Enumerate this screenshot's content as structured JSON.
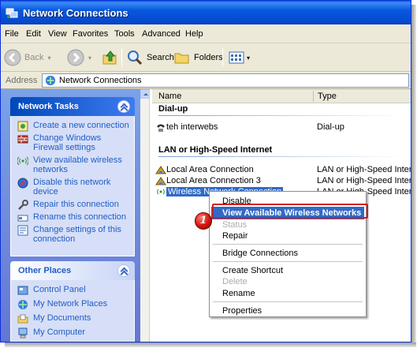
{
  "window": {
    "title": "Network Connections"
  },
  "menubar": {
    "items": [
      "File",
      "Edit",
      "View",
      "Favorites",
      "Tools",
      "Advanced",
      "Help"
    ]
  },
  "toolbar": {
    "back_label": "Back",
    "search_label": "Search",
    "folders_label": "Folders"
  },
  "addressbar": {
    "label": "Address",
    "value": "Network Connections"
  },
  "network_tasks": {
    "title": "Network Tasks",
    "items": [
      {
        "label": "Create a new connection",
        "icon": "new-connection-icon"
      },
      {
        "label": "Change Windows Firewall settings",
        "icon": "firewall-icon"
      },
      {
        "label": "View available wireless networks",
        "icon": "wireless-icon"
      },
      {
        "label": "Disable this network device",
        "icon": "disable-icon"
      },
      {
        "label": "Repair this connection",
        "icon": "repair-icon"
      },
      {
        "label": "Rename this connection",
        "icon": "rename-icon"
      },
      {
        "label": "Change settings of this connection",
        "icon": "settings-icon"
      }
    ]
  },
  "other_places": {
    "title": "Other Places",
    "items": [
      {
        "label": "Control Panel",
        "icon": "control-panel-icon"
      },
      {
        "label": "My Network Places",
        "icon": "network-places-icon"
      },
      {
        "label": "My Documents",
        "icon": "documents-icon"
      },
      {
        "label": "My Computer",
        "icon": "computer-icon"
      }
    ]
  },
  "columns": {
    "name": "Name",
    "type": "Type"
  },
  "groups": {
    "dialup": {
      "title": "Dial-up"
    },
    "lan": {
      "title": "LAN or High-Speed Internet"
    }
  },
  "connections": [
    {
      "name": "teh interwebs",
      "type": "Dial-up"
    },
    {
      "name": "Local Area Connection",
      "type": "LAN or High-Speed Inter..."
    },
    {
      "name": "Local Area Connection 3",
      "type": "LAN or High-Speed Inter..."
    },
    {
      "name": "Wireless Network Connection",
      "type": "LAN or High-Speed Inter..."
    }
  ],
  "context_menu": {
    "items": [
      {
        "label": "Disable",
        "disabled": false
      },
      {
        "label": "View Available Wireless Networks",
        "highlighted": true
      },
      {
        "label": "Status",
        "disabled": true
      },
      {
        "label": "Repair",
        "disabled": false
      },
      {
        "label": "Bridge Connections",
        "disabled": false
      },
      {
        "label": "Create Shortcut",
        "disabled": false
      },
      {
        "label": "Delete",
        "disabled": true
      },
      {
        "label": "Rename",
        "disabled": false
      },
      {
        "label": "Properties",
        "disabled": false
      }
    ]
  },
  "callout": {
    "number": "1"
  },
  "colors": {
    "title_bar": "#0858de",
    "task_link": "#215dc6",
    "selection": "#316ac5",
    "callout_red": "#d21b1b"
  }
}
